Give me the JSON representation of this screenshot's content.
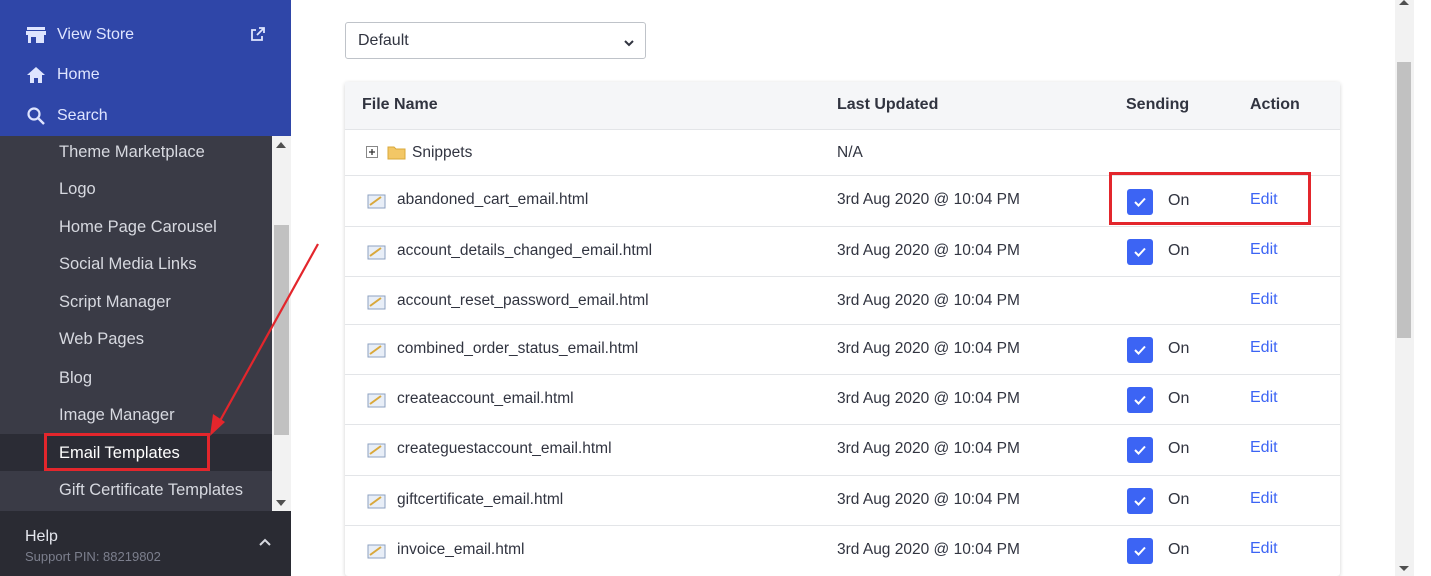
{
  "sidebar": {
    "top_items": [
      {
        "label": "View Store",
        "icon": "store-icon"
      },
      {
        "label": "Home",
        "icon": "home-icon"
      },
      {
        "label": "Search",
        "icon": "search-icon"
      }
    ],
    "items": [
      {
        "label": "Theme Marketplace"
      },
      {
        "label": "Logo"
      },
      {
        "label": "Home Page Carousel"
      },
      {
        "label": "Social Media Links"
      },
      {
        "label": "Script Manager"
      },
      {
        "label": "Web Pages"
      },
      {
        "label": "Blog"
      },
      {
        "label": "Image Manager"
      },
      {
        "label": "Email Templates"
      },
      {
        "label": "Gift Certificate Templates"
      }
    ],
    "help": {
      "title": "Help",
      "pin": "Support PIN: 88219802"
    }
  },
  "filter": {
    "selected": "Default"
  },
  "table": {
    "headers": {
      "file_name": "File Name",
      "last_updated": "Last Updated",
      "sending": "Sending",
      "action": "Action"
    },
    "folder": {
      "name": "Snippets",
      "updated": "N/A"
    },
    "rows": [
      {
        "file": "abandoned_cart_email.html",
        "updated": "3rd Aug 2020 @ 10:04 PM",
        "sending": "On",
        "action": "Edit"
      },
      {
        "file": "account_details_changed_email.html",
        "updated": "3rd Aug 2020 @ 10:04 PM",
        "sending": "On",
        "action": "Edit"
      },
      {
        "file": "account_reset_password_email.html",
        "updated": "3rd Aug 2020 @ 10:04 PM",
        "sending": "",
        "action": "Edit"
      },
      {
        "file": "combined_order_status_email.html",
        "updated": "3rd Aug 2020 @ 10:04 PM",
        "sending": "On",
        "action": "Edit"
      },
      {
        "file": "createaccount_email.html",
        "updated": "3rd Aug 2020 @ 10:04 PM",
        "sending": "On",
        "action": "Edit"
      },
      {
        "file": "createguestaccount_email.html",
        "updated": "3rd Aug 2020 @ 10:04 PM",
        "sending": "On",
        "action": "Edit"
      },
      {
        "file": "giftcertificate_email.html",
        "updated": "3rd Aug 2020 @ 10:04 PM",
        "sending": "On",
        "action": "Edit"
      },
      {
        "file": "invoice_email.html",
        "updated": "3rd Aug 2020 @ 10:04 PM",
        "sending": "On",
        "action": "Edit"
      }
    ]
  },
  "colors": {
    "accent": "#3c64f4",
    "annotation": "#e3262c",
    "sidebar_top": "#2f46a8",
    "sidebar": "#3a3b46"
  }
}
